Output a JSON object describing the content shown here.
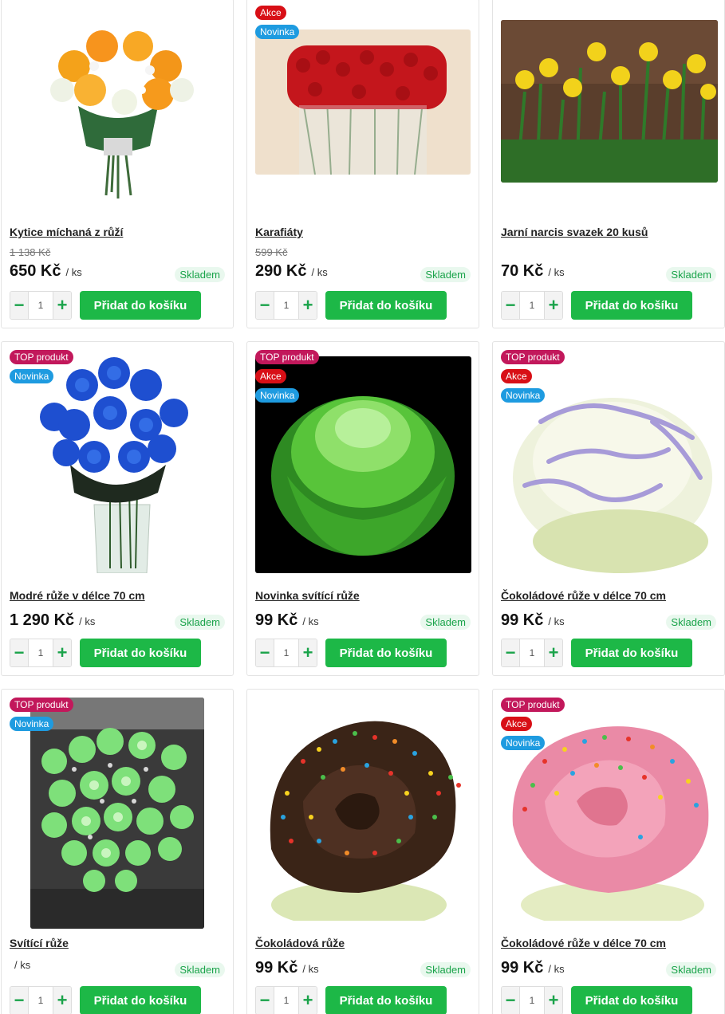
{
  "common": {
    "unit": "/ ks",
    "stock": "Skladem",
    "add_to_cart": "Přidat do košíku",
    "qty_default": "1",
    "minus": "−",
    "plus": "+"
  },
  "products": [
    {
      "name": "Kytice míchaná z růží",
      "old_price": "1 138 Kč",
      "price": "650 Kč",
      "badges": []
    },
    {
      "name": "Karafiáty",
      "old_price": "599 Kč",
      "price": "290 Kč",
      "badges": [
        "Akce",
        "Novinka"
      ]
    },
    {
      "name": "Jarní narcis svazek 20 kusů",
      "old_price": "",
      "price": "70 Kč",
      "badges": []
    },
    {
      "name": "Modré růže v délce 70 cm",
      "old_price": "",
      "price": "1 290 Kč",
      "badges": [
        "TOP produkt",
        "Novinka"
      ]
    },
    {
      "name": "Novinka svítící růže",
      "old_price": "",
      "price": "99 Kč",
      "badges": [
        "TOP produkt",
        "Akce",
        "Novinka"
      ]
    },
    {
      "name": "Čokoládové růže v délce 70 cm",
      "old_price": "",
      "price": "99 Kč",
      "badges": [
        "TOP produkt",
        "Akce",
        "Novinka"
      ]
    },
    {
      "name": "Svítící růže",
      "old_price": "",
      "price": "",
      "badges": [
        "TOP produkt",
        "Novinka"
      ]
    },
    {
      "name": "Čokoládová růže",
      "old_price": "",
      "price": "99 Kč",
      "badges": []
    },
    {
      "name": "Čokoládové růže v délce 70 cm",
      "old_price": "",
      "price": "99 Kč",
      "badges": [
        "TOP produkt",
        "Akce",
        "Novinka"
      ]
    }
  ],
  "colors": {
    "badge_top": "#c2185b",
    "badge_akce": "#d80f16",
    "badge_novinka": "#1e9be0",
    "add_button": "#1db847",
    "stock": "#1aa34a"
  }
}
